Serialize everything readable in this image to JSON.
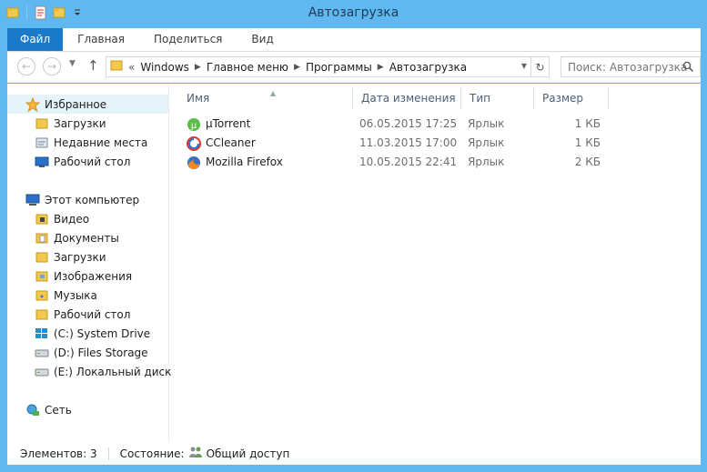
{
  "window": {
    "title": "Автозагрузка",
    "frame_color": "#5fb8f0",
    "accent_color": "#1979ca"
  },
  "quick_access": {
    "icons": [
      "folder-icon",
      "properties-icon",
      "new-folder-icon",
      "customize-dropdown-icon"
    ]
  },
  "ribbon": {
    "tabs": [
      {
        "label": "Файл",
        "active": true
      },
      {
        "label": "Главная"
      },
      {
        "label": "Поделиться"
      },
      {
        "label": "Вид"
      }
    ]
  },
  "address": {
    "prefix": "«",
    "crumbs": [
      "Windows",
      "Главное меню",
      "Программы",
      "Автозагрузка"
    ]
  },
  "search": {
    "placeholder": "Поиск: Автозагрузка"
  },
  "navigation": {
    "favorites": {
      "label": "Избранное",
      "items": [
        "Загрузки",
        "Недавние места",
        "Рабочий стол"
      ]
    },
    "computer": {
      "label": "Этот компьютер",
      "items": [
        "Видео",
        "Документы",
        "Загрузки",
        "Изображения",
        "Музыка",
        "Рабочий стол",
        "(C:) System Drive",
        "(D:) Files Storage",
        "(E:) Локальный диск"
      ]
    },
    "network": {
      "label": "Сеть"
    }
  },
  "file_list": {
    "columns": [
      "Имя",
      "Дата изменения",
      "Тип",
      "Размер"
    ],
    "rows": [
      {
        "name": "µTorrent",
        "date": "06.05.2015 17:25",
        "type": "Ярлык",
        "size": "1 КБ",
        "icon": "utorrent-icon"
      },
      {
        "name": "CCleaner",
        "date": "11.03.2015 17:00",
        "type": "Ярлык",
        "size": "1 КБ",
        "icon": "ccleaner-icon"
      },
      {
        "name": "Mozilla Firefox",
        "date": "10.05.2015 22:41",
        "type": "Ярлык",
        "size": "2 КБ",
        "icon": "firefox-icon"
      }
    ]
  },
  "status": {
    "count": "Элементов: 3",
    "state_label": "Состояние:",
    "state_value": "Общий доступ"
  }
}
